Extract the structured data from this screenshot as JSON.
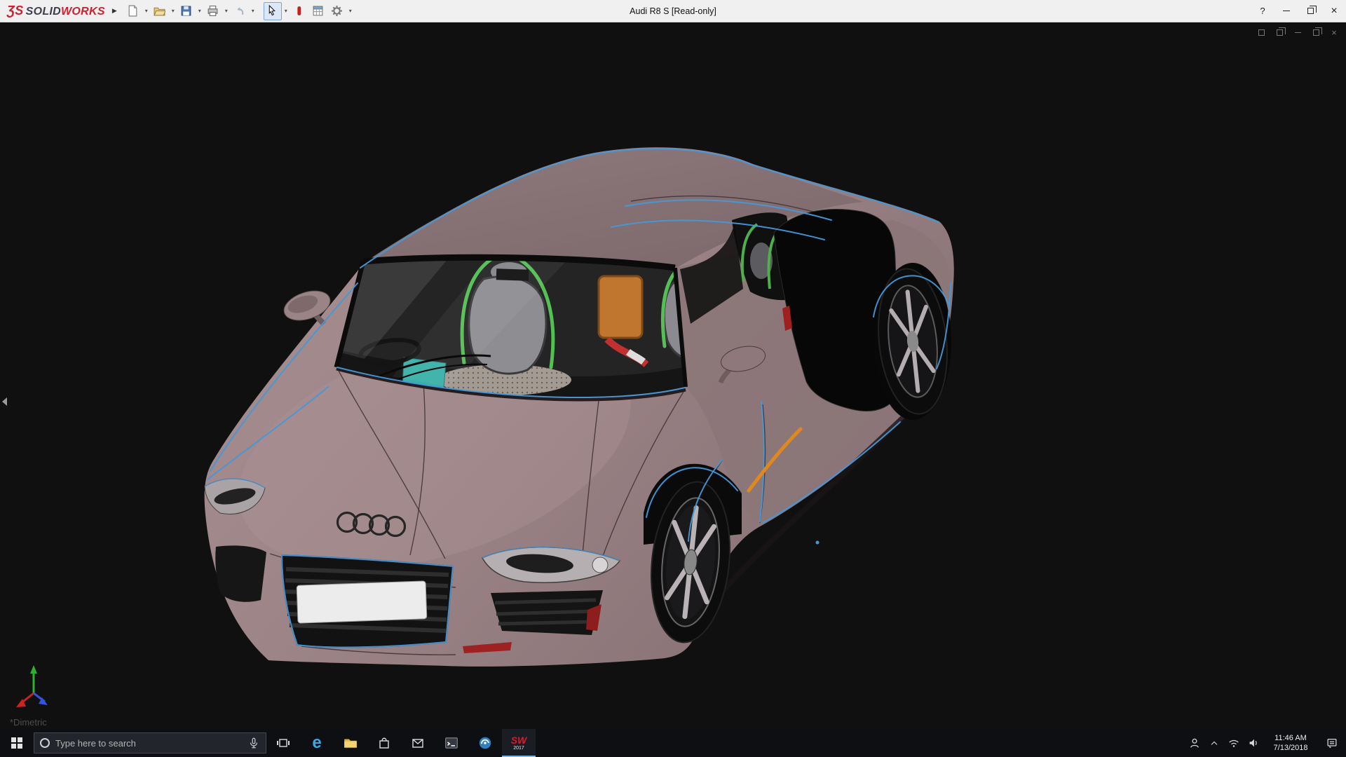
{
  "colors": {
    "car-body": "#9c8487",
    "accent-blue": "#4598d8",
    "cage-green": "#54c054",
    "stripe-orange": "#e08820",
    "taskbar-bg": "#0d0f13",
    "titlebar-bg": "#f0f0f0"
  },
  "titlebar": {
    "logo_mark": "ƷS",
    "brand_solid": "SOLID",
    "brand_works": "WORKS",
    "flyout": "▶",
    "title": "Audi R8 S [Read-only]",
    "help_glyph": "?",
    "close_glyph": "×"
  },
  "toolbar": {
    "caret": "▾",
    "items": [
      {
        "name": "new-document"
      },
      {
        "name": "open"
      },
      {
        "name": "save"
      },
      {
        "name": "print"
      },
      {
        "name": "undo"
      },
      {
        "name": "select"
      },
      {
        "name": "red-tool"
      },
      {
        "name": "table"
      },
      {
        "name": "options-gear"
      }
    ]
  },
  "viewport": {
    "view_label": "*Dimetric",
    "close_glyph": "×",
    "doc_controls": [
      "new-window",
      "cascade",
      "minimize",
      "restore",
      "close"
    ]
  },
  "taskbar": {
    "search_placeholder": "Type here to search",
    "edge_glyph": "e",
    "sw_badge": "SW",
    "sw_year": "2017",
    "apps": [
      "task-view",
      "edge",
      "file-explorer",
      "store",
      "mail",
      "console",
      "solidworks-tool",
      "solidworks-2017"
    ],
    "tray_time": "11:46 AM",
    "tray_date": "7/13/2018"
  }
}
